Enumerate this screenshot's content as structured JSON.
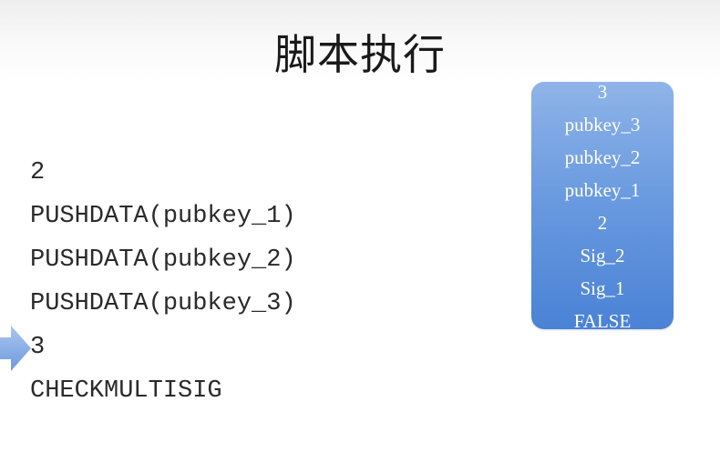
{
  "title": "脚本执行",
  "script": {
    "lines": [
      "2",
      "PUSHDATA(pubkey_1)",
      "PUSHDATA(pubkey_2)",
      "PUSHDATA(pubkey_3)",
      "3",
      "CHECKMULTISIG"
    ],
    "current_line": "3"
  },
  "stack": {
    "items": [
      "3",
      "pubkey_3",
      "pubkey_2",
      "pubkey_1",
      "2",
      "Sig_2",
      "Sig_1",
      "FALSE"
    ]
  },
  "colors": {
    "arrow": "#7ea6e0",
    "stack_top": "#8fb4e8",
    "stack_bottom": "#4a82d6"
  },
  "icons": {
    "pointer": "right-arrow-icon"
  }
}
